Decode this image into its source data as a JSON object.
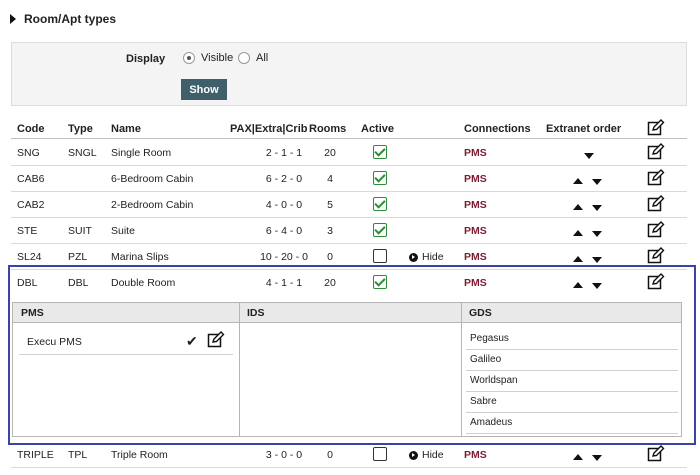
{
  "section": {
    "title": "Room/Apt types"
  },
  "filter": {
    "label": "Display",
    "options": [
      {
        "label": "Visible",
        "checked": true
      },
      {
        "label": "All",
        "checked": false
      }
    ],
    "button_label": "Show"
  },
  "table": {
    "headers": {
      "code": "Code",
      "type": "Type",
      "name": "Name",
      "pax": "PAX|Extra|Crib",
      "rooms": "Rooms",
      "active": "Active",
      "connections": "Connections",
      "extranet_order": "Extranet order"
    },
    "rows": [
      {
        "code": "SNG",
        "type": "SNGL",
        "name": "Single Room",
        "pax": "2 - 1 - 1",
        "rooms": "20",
        "active": true,
        "hide": "",
        "connection": "PMS"
      },
      {
        "code": "CAB6",
        "type": "",
        "name": "6-Bedroom Cabin",
        "pax": "6 - 2 - 0",
        "rooms": "4",
        "active": true,
        "hide": "",
        "connection": "PMS"
      },
      {
        "code": "CAB2",
        "type": "",
        "name": "2-Bedroom Cabin",
        "pax": "4 - 0 - 0",
        "rooms": "5",
        "active": true,
        "hide": "",
        "connection": "PMS"
      },
      {
        "code": "STE",
        "type": "SUIT",
        "name": "Suite",
        "pax": "6 - 4 - 0",
        "rooms": "3",
        "active": true,
        "hide": "",
        "connection": "PMS"
      },
      {
        "code": "SL24",
        "type": "PZL",
        "name": "Marina Slips",
        "pax": "10 - 20 - 0",
        "rooms": "0",
        "active": false,
        "hide": "Hide",
        "connection": "PMS"
      },
      {
        "code": "DBL",
        "type": "DBL",
        "name": "Double Room",
        "pax": "4 - 1 - 1",
        "rooms": "20",
        "active": true,
        "hide": "",
        "connection": "PMS"
      },
      {
        "code": "TRIPLE",
        "type": "TPL",
        "name": "Triple Room",
        "pax": "3 - 0 - 0",
        "rooms": "0",
        "active": false,
        "hide": "Hide",
        "connection": "PMS"
      }
    ]
  },
  "detail": {
    "headers": {
      "pms": "PMS",
      "ids": "IDS",
      "gds": "GDS"
    },
    "pms_items": [
      "Execu PMS"
    ],
    "gds_items": [
      "Pegasus",
      "Galileo",
      "Worldspan",
      "Sabre",
      "Amadeus"
    ]
  },
  "colors": {
    "accent_button": "#3f5f6b",
    "connection_link": "#7a1d2e",
    "active_check": "#2e8b3a",
    "highlight_border": "#3a44a8"
  }
}
